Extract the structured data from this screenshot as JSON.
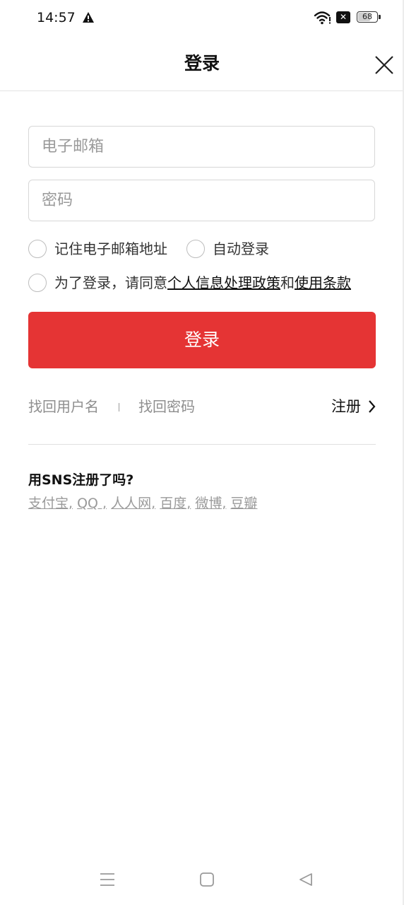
{
  "status_bar": {
    "time": "14:57",
    "battery": "68",
    "icons": [
      "warning-icon",
      "wifi-icon",
      "sim-x-icon",
      "battery-icon"
    ]
  },
  "header": {
    "title": "登录"
  },
  "form": {
    "email_placeholder": "电子邮箱",
    "email_value": "",
    "password_placeholder": "密码",
    "password_value": "",
    "remember_email_label": "记住电子邮箱地址",
    "auto_login_label": "自动登录",
    "agree_prefix": "为了登录，请同意",
    "privacy_policy_link": "个人信息处理政策",
    "agree_and": "和",
    "terms_link": "使用条款",
    "login_button": "登录"
  },
  "links": {
    "find_username": "找回用户名",
    "find_password": "找回密码",
    "register": "注册"
  },
  "sns": {
    "title": "用SNS注册了吗?",
    "providers": [
      "支付宝,",
      "QQ ,",
      "人人网,",
      "百度,",
      "微博,",
      "豆瓣"
    ]
  },
  "colors": {
    "accent": "#e53434",
    "muted_text": "#8e8e8e"
  }
}
